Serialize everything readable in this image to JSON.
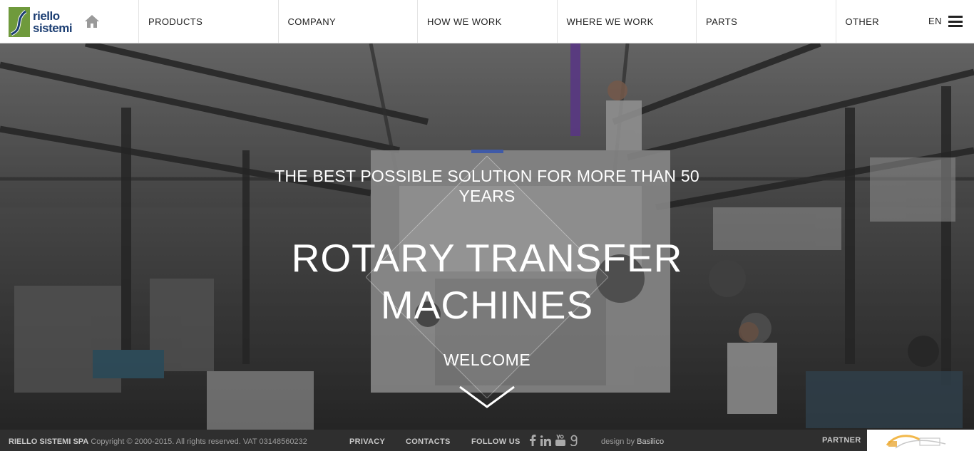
{
  "brand": {
    "line1": "riello",
    "line2": "sistemi",
    "colors": {
      "green": "#6f9a3c",
      "blue": "#1d3f73",
      "accent": "#3f5aa8"
    }
  },
  "header": {
    "home_icon": "home-icon",
    "nav": [
      {
        "label": "PRODUCTS"
      },
      {
        "label": "COMPANY"
      },
      {
        "label": "HOW WE WORK"
      },
      {
        "label": "WHERE WE WORK"
      },
      {
        "label": "PARTS"
      },
      {
        "label": "OTHER"
      }
    ],
    "language": "EN",
    "menu_icon": "hamburger-menu-icon"
  },
  "hero": {
    "tagline": "THE BEST POSSIBLE SOLUTION FOR MORE THAN 50 YEARS",
    "title_line1": "ROTARY TRANSFER",
    "title_line2": "MACHINES",
    "welcome": "WELCOME",
    "scroll_icon": "chevron-down-icon"
  },
  "footer": {
    "company": "RIELLO SISTEMI SPA",
    "copyright": "Copyright © 2000-2015. All rights reserved. VAT 03148560232",
    "privacy": "PRIVACY",
    "contacts": "CONTACTS",
    "follow_us": "FOLLOW US",
    "social": [
      {
        "icon": "facebook-icon",
        "glyph": "f"
      },
      {
        "icon": "linkedin-icon",
        "glyph": "in"
      },
      {
        "icon": "youtube-icon",
        "glyph": "You"
      },
      {
        "icon": "google-plus-icon",
        "glyph": "g"
      }
    ],
    "design_by": "design by",
    "designer": "Basilico",
    "partner": "PARTNER"
  }
}
